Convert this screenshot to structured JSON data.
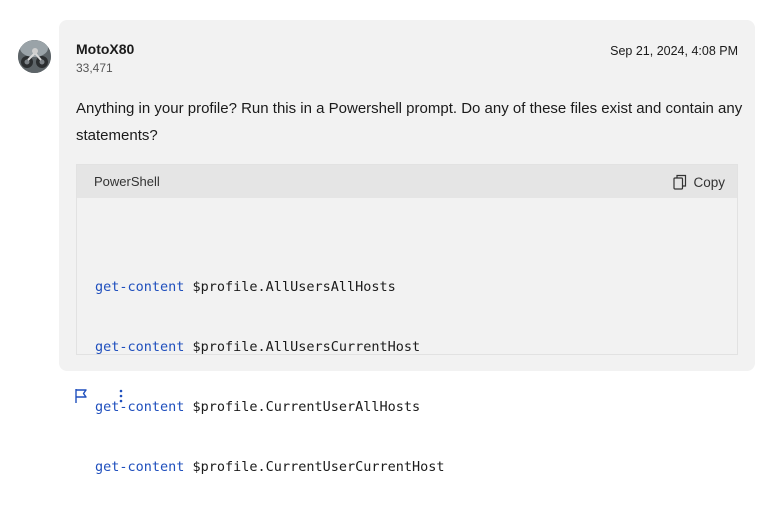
{
  "author": {
    "name": "MotoX80",
    "points": "33,471",
    "avatar_icon": "user-avatar-photo"
  },
  "post": {
    "date": "Sep 21, 2024, 4:08 PM",
    "body": "Anything in your profile? Run this in a Powershell prompt. Do any of these files exist and contain any statements?"
  },
  "code": {
    "language": "PowerShell",
    "copy_label": "Copy",
    "copy_icon": "copy-icon",
    "lines": [
      {
        "keyword": "get-content",
        "arg": " $profile.AllUsersAllHosts"
      },
      {
        "keyword": "get-content",
        "arg": " $profile.AllUsersCurrentHost"
      },
      {
        "keyword": "get-content",
        "arg": " $profile.CurrentUserAllHosts"
      },
      {
        "keyword": "get-content",
        "arg": " $profile.CurrentUserCurrentHost"
      }
    ]
  },
  "actions": {
    "report_icon": "flag-icon",
    "more_icon": "more-vertical-icon"
  },
  "colors": {
    "card_bg": "#f2f2f2",
    "code_header_bg": "#e5e5e5",
    "keyword": "#1f4fbd",
    "action_icon": "#1f4fbd"
  }
}
